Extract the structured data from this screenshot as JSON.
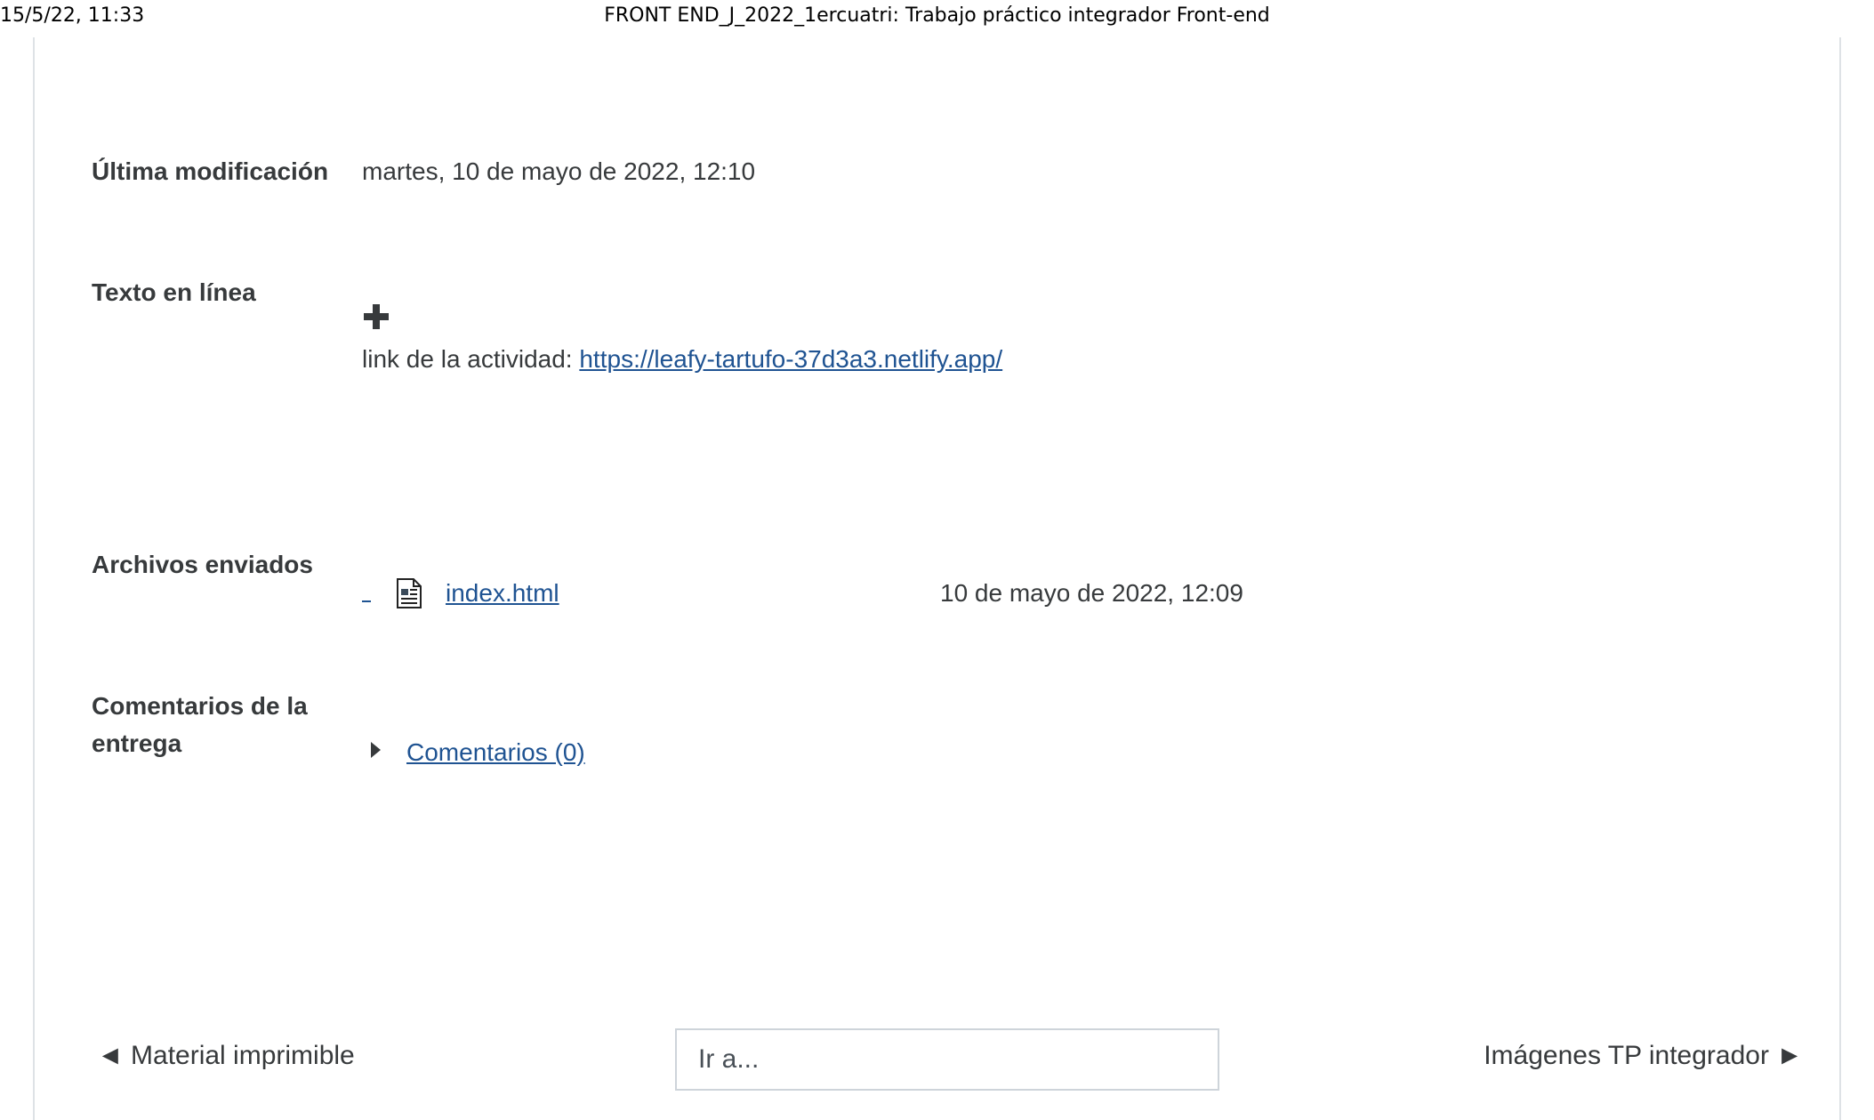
{
  "print_header": {
    "date": "15/5/22, 11:33",
    "title": "FRONT END_J_2022_1ercuatri: Trabajo práctico integrador Front-end"
  },
  "submission": {
    "last_modified_label": "Última modificación",
    "last_modified_value": "martes, 10 de mayo de 2022, 12:10",
    "online_text_label": "Texto en línea",
    "online_text_prefix": "link de la actividad: ",
    "online_text_link": "https://leafy-tartufo-37d3a3.netlify.app/",
    "files_label": "Archivos enviados",
    "file_name": "index.html",
    "file_date": "10 de mayo de 2022, 12:09",
    "comments_label": "Comentarios de la entrega",
    "comments_link": "Comentarios (0)"
  },
  "navigation": {
    "prev": "◄ Material imprimible",
    "jump_placeholder": "Ir a...",
    "next": "Imágenes TP integrador ►"
  },
  "icons": {
    "expand": "plus-icon",
    "file": "document-icon",
    "collapse": "caret-right-icon"
  }
}
